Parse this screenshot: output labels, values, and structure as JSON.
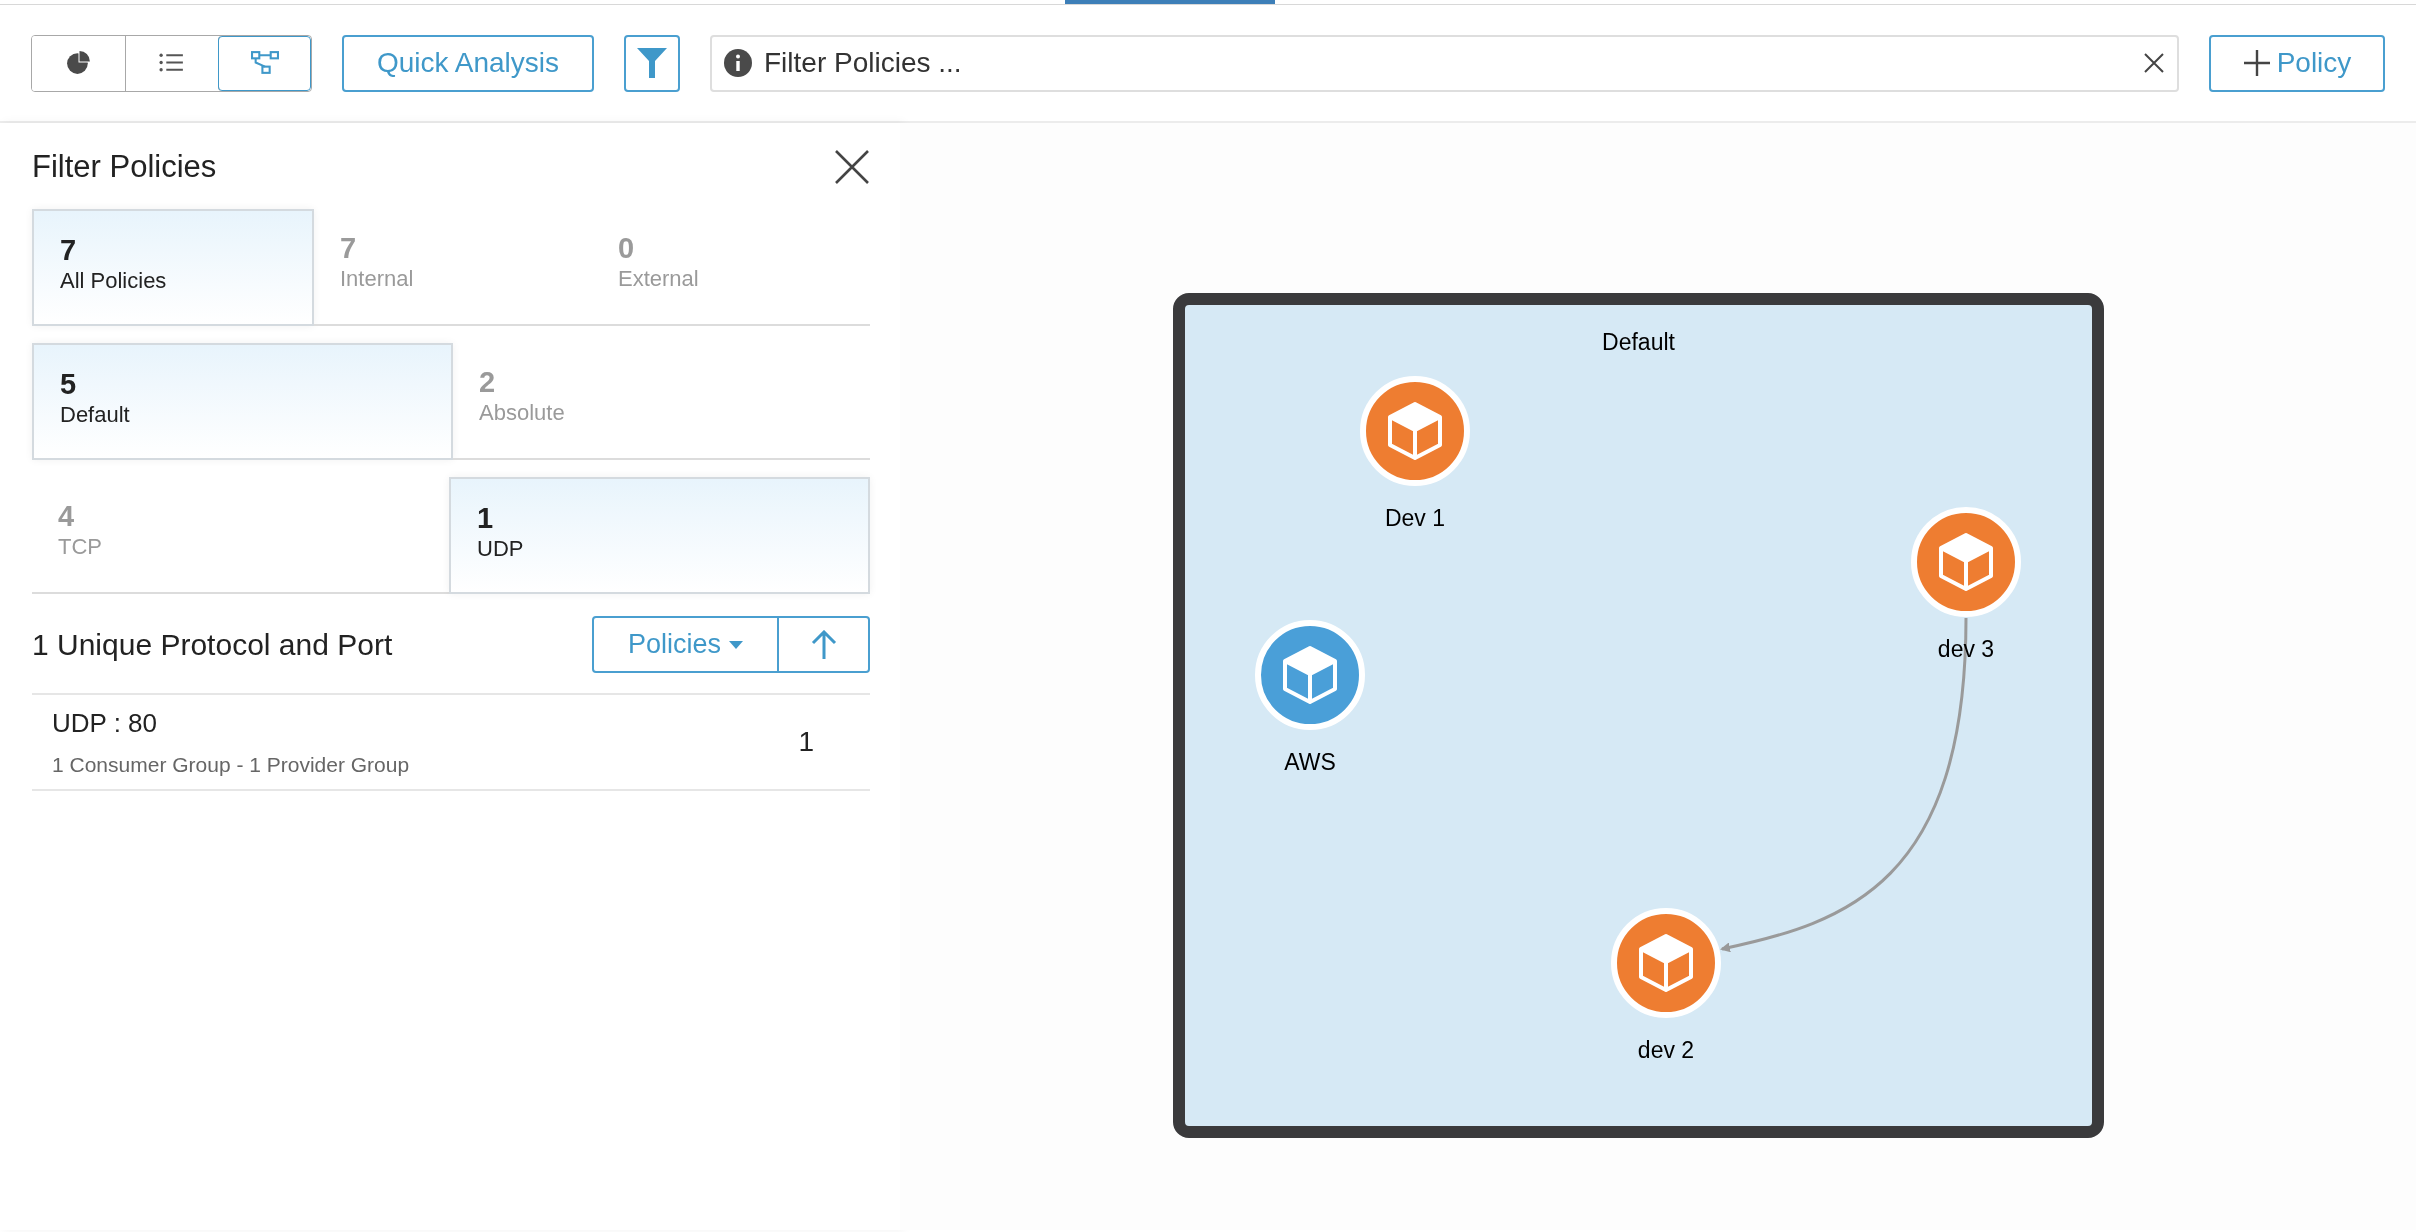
{
  "toolbar": {
    "views": [
      {
        "kind": "pie",
        "selected": false
      },
      {
        "kind": "list",
        "selected": false
      },
      {
        "kind": "topology",
        "selected": true
      }
    ],
    "quick_analysis": "Quick Analysis",
    "search": {
      "placeholder": "Filter Policies ..."
    },
    "add_button": "Policy"
  },
  "filter_panel": {
    "title": "Filter Policies",
    "tile_rows": [
      [
        {
          "count": "7",
          "label": "All Policies",
          "selected": true
        },
        {
          "count": "7",
          "label": "Internal",
          "selected": false
        },
        {
          "count": "0",
          "label": "External",
          "selected": false
        }
      ],
      [
        {
          "count": "5",
          "label": "Default",
          "selected": true
        },
        {
          "count": "2",
          "label": "Absolute",
          "selected": false
        }
      ],
      [
        {
          "count": "4",
          "label": "TCP",
          "selected": false
        },
        {
          "count": "1",
          "label": "UDP",
          "selected": true
        }
      ]
    ],
    "list_title": "1 Unique Protocol and Port",
    "sort_button": "Policies",
    "rows": [
      {
        "name": "UDP : 80",
        "detail": "1 Consumer Group - 1 Provider Group",
        "count": "1"
      }
    ]
  },
  "diagram": {
    "group": "Default",
    "nodes": [
      {
        "label": "Dev 1",
        "color": "#ee7d31"
      },
      {
        "label": "dev 3",
        "color": "#ee7d31"
      },
      {
        "label": "AWS",
        "color": "#4a9fd8"
      },
      {
        "label": "dev 2",
        "color": "#ee7d31"
      }
    ],
    "edges": [
      {
        "kind": "arrow"
      }
    ]
  }
}
